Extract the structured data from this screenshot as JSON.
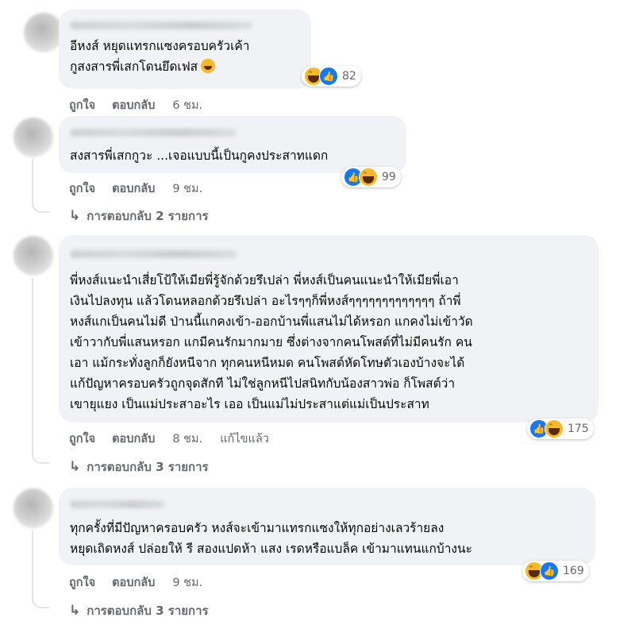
{
  "comments": [
    {
      "lines": [
        "อีหงส์ หยุดแทรกแซงครอบครัวเค้า",
        "กูสงสารพี่เสกโดนยึดเฟส"
      ],
      "trailing_emoji": "rolling-on-floor-laughing",
      "reaction_icons": [
        "haha",
        "like"
      ],
      "reaction_count": "82",
      "like_label": "ถูกใจ",
      "reply_label": "ตอบกลับ",
      "time": "6 ชม."
    },
    {
      "lines": [
        "สงสารพี่เสกกูวะ ...เจอแบบนี้เป็นกูคงประสาทแดก"
      ],
      "reaction_icons": [
        "like",
        "haha"
      ],
      "reaction_count": "99",
      "like_label": "ถูกใจ",
      "reply_label": "ตอบกลับ",
      "time": "9 ชม.",
      "replies_label": "การตอบกลับ 2 รายการ"
    },
    {
      "lines": [
        "พี่หงส์แนะนำเสี่ยโป้ให้เมียพี่รู้จักด้วยรึเปล่า พี่หงส์เป็นคนแนะนำให้เมียพี่เอา",
        "เงินไปลงทุน แล้วโดนหลอกด้วยรึเปล่า อะไรๆๆก็พี่หงส์ๆๆๆๆๆๆๆๆๆๆๆๆๆ ถ้าพี่",
        "หงส์แกเป็นคนไม่ดี ป่านนี้แกคงเข้า-ออกบ้านพี่แสนไม่ได้หรอก แกคงไม่เข้าวัด",
        "เข้าวากับพี่แสนหรอก แกมีคนรักมากมาย ซึ่งต่างจากคนโพสต์ที่ไม่มีคนรัก คน",
        "เอา แม้กระทั่งลูกก็ยังหนีจาก ทุกคนหนีหมด คนโพสต์หัดโทษตัวเองบ้างจะได้",
        "แก้ปัญหาครอบครัวถูกจุดสักที ไม่ใช่ลูกหนีไปสนิทกับน้องสาวพ่อ ก็โพสต์ว่า",
        "เขายุแยง เป็นแม่ประสาอะไร เออ เป็นแม่ไม่ประสาแต่แม่เป็นประสาท"
      ],
      "reaction_icons": [
        "like",
        "haha"
      ],
      "reaction_count": "175",
      "like_label": "ถูกใจ",
      "reply_label": "ตอบกลับ",
      "time": "8 ชม.",
      "edited_label": "แก้ไขแล้ว",
      "replies_label": "การตอบกลับ 3 รายการ"
    },
    {
      "lines": [
        "ทุกครั้งที่มีปัญหาครอบครัว หงส์จะเข้ามาแทรกแซงให้ทุกอย่างเลวร้ายลง",
        "หยุดเถิดหงส์ ปล่อยให้ รี สองแปดห้า แสง เรดหรือแบล็ค เข้ามาแทนแกบ้างนะ"
      ],
      "reaction_icons": [
        "haha",
        "like"
      ],
      "reaction_count": "169",
      "like_label": "ถูกใจ",
      "reply_label": "ตอบกลับ",
      "time": "9 ชม.",
      "replies_label": "การตอบกลับ 3 รายการ"
    }
  ],
  "colors": {
    "bubble": "#f0f2f5",
    "meta": "#65676b",
    "like_blue": "#1877f2",
    "haha_yellow": "#f7b928"
  }
}
